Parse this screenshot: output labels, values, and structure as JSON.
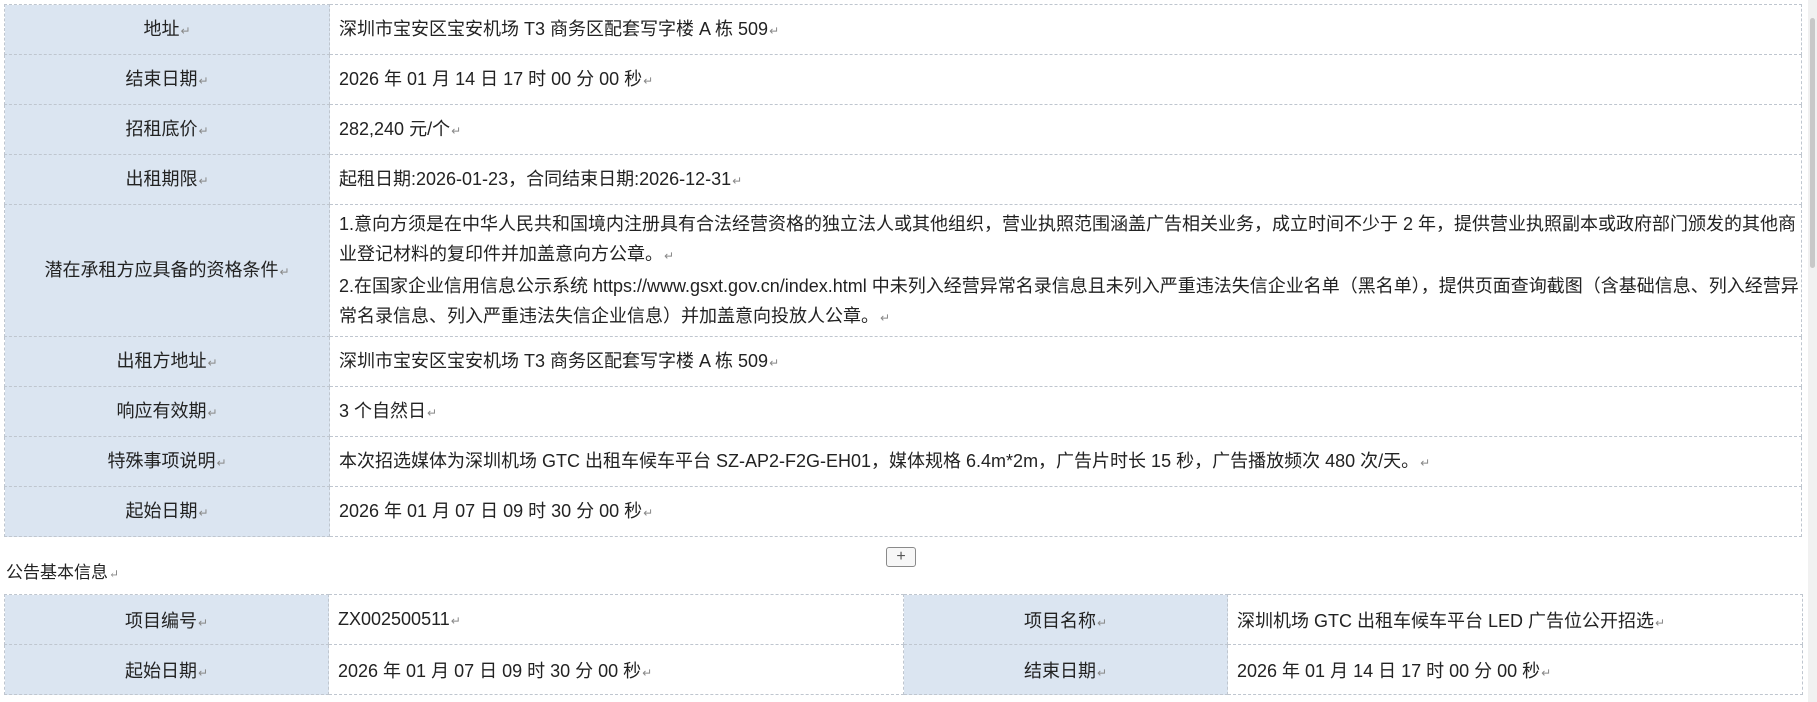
{
  "table1": {
    "rows": [
      {
        "label": "地址",
        "value": "深圳市宝安区宝安机场 T3 商务区配套写字楼 A 栋 509"
      },
      {
        "label": "结束日期",
        "value": "2026 年 01 月 14 日 17 时 00 分 00 秒"
      },
      {
        "label": "招租底价",
        "value": "282,240 元/个"
      },
      {
        "label": "出租期限",
        "value": "起租日期:2026-01-23，合同结束日期:2026-12-31"
      },
      {
        "label": "潜在承租方应具备的资格条件",
        "lines": [
          "1.意向方须是在中华人民共和国境内注册具有合法经营资格的独立法人或其他组织，营业执照范围涵盖广告相关业务，成立时间不少于 2 年，提供营业执照副本或政府部门颁发的其他商业登记材料的复印件并加盖意向方公章。",
          "2.在国家企业信用信息公示系统 https://www.gsxt.gov.cn/index.html 中未列入经营异常名录信息且未列入严重违法失信企业名单（黑名单），提供页面查询截图（含基础信息、列入经营异常名录信息、列入严重违法失信企业信息）并加盖意向投放人公章。"
        ]
      },
      {
        "label": "出租方地址",
        "value": "深圳市宝安区宝安机场 T3 商务区配套写字楼 A 栋 509"
      },
      {
        "label": "响应有效期",
        "value": "3 个自然日"
      },
      {
        "label": "特殊事项说明",
        "value": "本次招选媒体为深圳机场 GTC 出租车候车平台 SZ-AP2-F2G-EH01，媒体规格 6.4m*2m，广告片时长 15 秒，广告播放频次 480 次/天。"
      },
      {
        "label": "起始日期",
        "value": "2026 年 01 月 07 日 09 时 30 分 00 秒"
      }
    ]
  },
  "expand_button": {
    "label": "+"
  },
  "section": {
    "title": "公告基本信息"
  },
  "table2": {
    "rows": [
      {
        "label1": "项目编号",
        "value1": "ZX002500511",
        "label2": "项目名称",
        "value2": "深圳机场 GTC 出租车候车平台 LED 广告位公开招选"
      },
      {
        "label1": "起始日期",
        "value1": "2026 年 01 月 07 日 09 时 30 分 00 秒",
        "label2": "结束日期",
        "value2": "2026 年 01 月 14 日 17 时 00 分 00 秒"
      }
    ]
  },
  "paragraph_mark": "↵"
}
